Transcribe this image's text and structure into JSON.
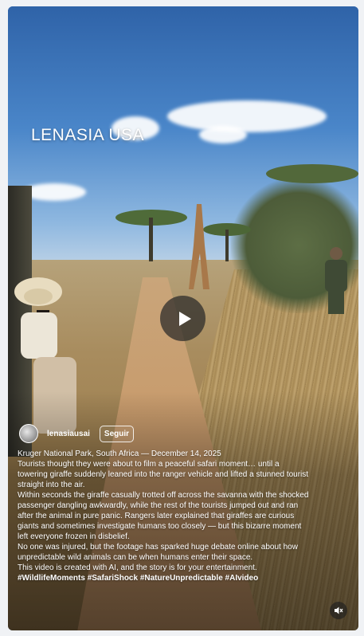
{
  "video": {
    "watermark": "LENASIA USA",
    "play_icon": "play-icon",
    "mute_icon": "muted-speaker-icon"
  },
  "author": {
    "name": "lenasiausai",
    "follow_label": "Seguir"
  },
  "caption": {
    "lines": [
      "Kruger National Park, South Africa — December 14, 2025",
      "Tourists thought they were about to film a peaceful safari moment… until a towering giraffe suddenly leaned into the ranger vehicle and lifted a stunned tourist straight into the air.",
      "Within seconds the giraffe casually trotted off across the savanna with the shocked passenger dangling awkwardly, while the rest of the tourists jumped out and ran after the animal in pure panic. Rangers later explained that giraffes are curious giants and sometimes investigate humans too closely — but this bizarre moment left everyone frozen in disbelief.",
      "No one was injured, but the footage has sparked huge debate online about how unpredictable wild animals can be when humans enter their space.",
      "This video is created with AI, and the story is for your entertainment."
    ],
    "hashtags": "#WildlifeMoments #SafariShock #NatureUnpredictable #AIvideo"
  },
  "colors": {
    "page_bg": "#f0f2f5",
    "text": "#ffffff"
  }
}
